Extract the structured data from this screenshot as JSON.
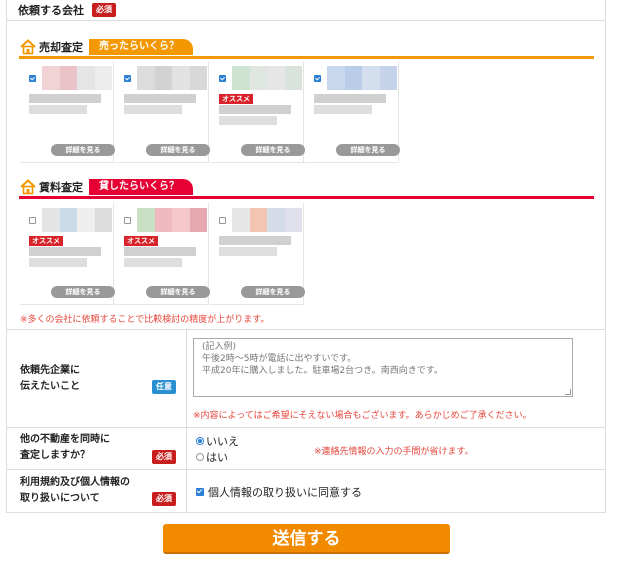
{
  "company": {
    "label": "依頼する会社",
    "required": "必須"
  },
  "sale": {
    "title": "売却査定",
    "tag": "売ったらいくら？",
    "cards": [
      {
        "checked": true,
        "recommended": false,
        "detail": "詳細を見る"
      },
      {
        "checked": true,
        "recommended": false,
        "detail": "詳細を見る"
      },
      {
        "checked": true,
        "recommended": true,
        "badge": "オススメ",
        "detail": "詳細を見る"
      },
      {
        "checked": true,
        "recommended": false,
        "detail": "詳細を見る"
      }
    ]
  },
  "rent": {
    "title": "賃料査定",
    "tag": "貸したらいくら？",
    "cards": [
      {
        "checked": false,
        "recommended": true,
        "badge": "オススメ",
        "detail": "詳細を見る"
      },
      {
        "checked": false,
        "recommended": true,
        "badge": "オススメ",
        "detail": "詳細を見る"
      },
      {
        "checked": false,
        "recommended": false,
        "detail": "詳細を見る"
      }
    ]
  },
  "accuracy_note": "※多くの会社に依頼することで比較検討の精度が上がります。",
  "message": {
    "label_line1": "依頼先企業に",
    "label_line2": "伝えたいこと",
    "optional": "任意",
    "placeholder_line1": "(記入例)",
    "placeholder_line2": "午後2時～5時が電話に出やすいです。",
    "placeholder_line3": "平成20年に購入しました。駐車場2台つき。南西向きです。",
    "note": "※内容によってはご希望にそえない場合もございます。あらかじめご了承ください。"
  },
  "simultaneous": {
    "label_line1": "他の不動産を同時に",
    "label_line2": "査定しますか？",
    "required": "必須",
    "option_no": "いいえ",
    "option_yes": "はい",
    "selected": "いいえ",
    "note": "※連絡先情報の入力の手間が省けます。"
  },
  "terms": {
    "label_line1": "利用規約及び個人情報の",
    "label_line2": "取り扱いについて",
    "required": "必須",
    "checkbox_label": "個人情報の取り扱いに同意する",
    "checked": true
  },
  "submit_label": "送信する",
  "colors": {
    "sale_accent": "#f39800",
    "rent_accent": "#e60033",
    "submit": "#f28a00",
    "required_badge": "#c81e1e",
    "optional_badge": "#2a8fd0",
    "note_red": "#e8463c"
  }
}
